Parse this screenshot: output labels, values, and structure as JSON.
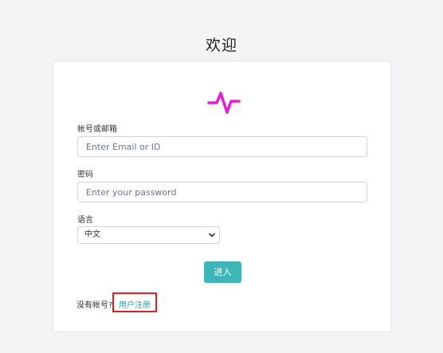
{
  "page": {
    "title": "欢迎"
  },
  "brand": {
    "logo_icon": "pulse-icon",
    "logo_color": "#e81ad6"
  },
  "form": {
    "account_label": "帐号或邮箱",
    "account_placeholder": "Enter Email or ID",
    "account_value": "",
    "password_label": "密码",
    "password_placeholder": "Enter your password",
    "password_value": "",
    "language_label": "语言",
    "language_selected": "中文",
    "submit_label": "进入",
    "submit_color": "#3eb5b8"
  },
  "footer": {
    "no_account_text": "没有帐号?",
    "register_link": "用户注册",
    "register_link_color": "#2a9fb0",
    "highlight_color": "#e02020"
  }
}
